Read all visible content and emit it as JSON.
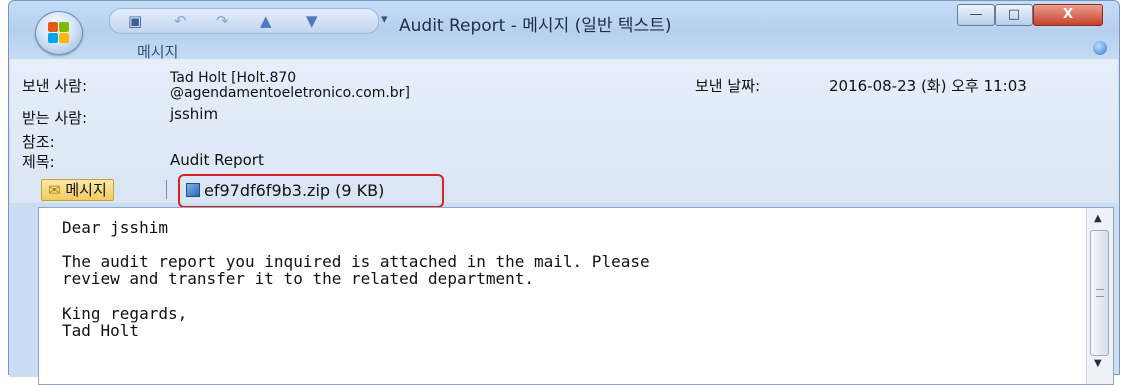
{
  "window": {
    "title": "Audit Report - 메시지 (일반 텍스트)",
    "qat_more": "▾",
    "buttons": {
      "minimize": "—",
      "maximize": "□",
      "close": "X"
    }
  },
  "ribbon": {
    "tab_label": "메시지"
  },
  "header": {
    "from_label": "보낸 사람:",
    "from_value_line1": "Tad Holt [Holt.870",
    "from_value_line2": "@agendamentoeletronico.com.br]",
    "sent_label": "보낸 날짜:",
    "sent_value": "2016-08-23 (화) 오후 11:03",
    "to_label": "받는 사람:",
    "to_value": "jsshim",
    "cc_label": "참조:",
    "subject_label": "제목:",
    "subject_value": "Audit Report"
  },
  "attachments": {
    "message_tab": "메시지",
    "file": "ef97df6f9b3.zip (9 KB)"
  },
  "body": {
    "line1": "Dear jsshim",
    "line2": "The audit report you inquired is attached in the mail. Please",
    "line3": "review and transfer it to the related department.",
    "line4": "King regards,",
    "line5": "Tad Holt"
  },
  "icons": [
    "office-orb-icon",
    "save-icon",
    "undo-icon",
    "redo-icon",
    "up-arrow-icon",
    "down-arrow-icon",
    "help-icon",
    "envelope-icon",
    "zip-file-icon",
    "scroll-up-icon",
    "scroll-down-icon"
  ],
  "colors": {
    "window_frame": "#b7d0ee",
    "header_bg": "#e6eefa",
    "highlight_border": "#d62424",
    "close_button": "#c8412b"
  }
}
